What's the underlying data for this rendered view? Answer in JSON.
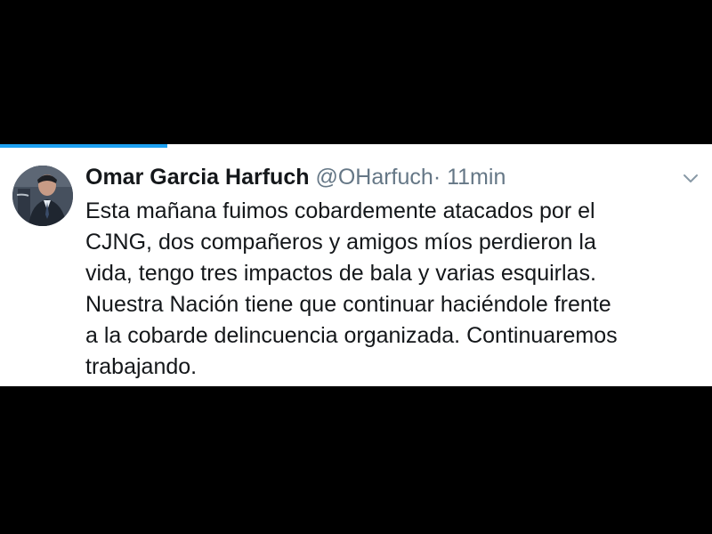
{
  "tweet": {
    "display_name": "Omar Garcia Harfuch",
    "handle": "@OHarfuch",
    "separator": "·",
    "timestamp": "11min",
    "text": "Esta mañana fuimos cobardemente atacados por el\nCJNG, dos compañeros y amigos míos perdieron la\nvida, tengo tres impactos de bala y varias esquirlas.\nNuestra Nación tiene que continuar haciéndole frente\na la cobarde delincuencia organizada. Continuaremos\ntrabajando."
  },
  "icons": {
    "menu": "chevron-down-icon",
    "avatar": "profile-photo"
  },
  "progress": {
    "fraction": 0.235
  },
  "colors": {
    "background": "#000000",
    "card": "#ffffff",
    "text": "#14171a",
    "muted": "#657786",
    "accent": "#1da1f2"
  }
}
